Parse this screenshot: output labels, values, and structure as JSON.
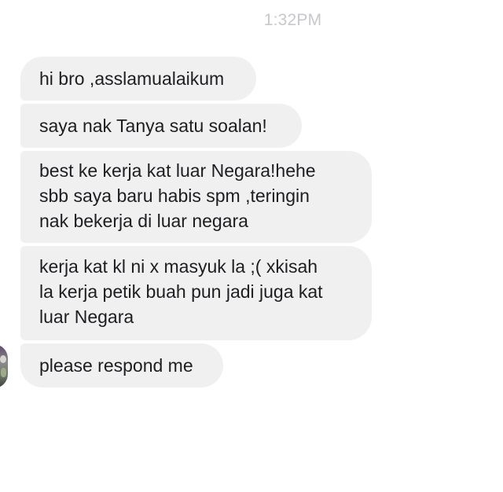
{
  "conversation": {
    "timestamp": "1:32PM",
    "messages": [
      {
        "text": "hi bro ,asslamualaikum"
      },
      {
        "text": "saya nak Tanya satu soalan!"
      },
      {
        "text": "best ke kerja kat luar Negara!hehe\nsbb saya baru habis spm ,teringin\nnak bekerja di luar negara"
      },
      {
        "text": "kerja kat kl ni x masyuk la ;( xkisah\nla kerja petik buah pun jadi juga kat\nluar Negara"
      },
      {
        "text": "please respond me"
      }
    ]
  },
  "colors": {
    "bubble_background": "#f1f0f0",
    "message_text": "#1c1e21",
    "timestamp_text": "#c8c8cc"
  },
  "icons": {
    "sender_avatar": "avatar"
  }
}
